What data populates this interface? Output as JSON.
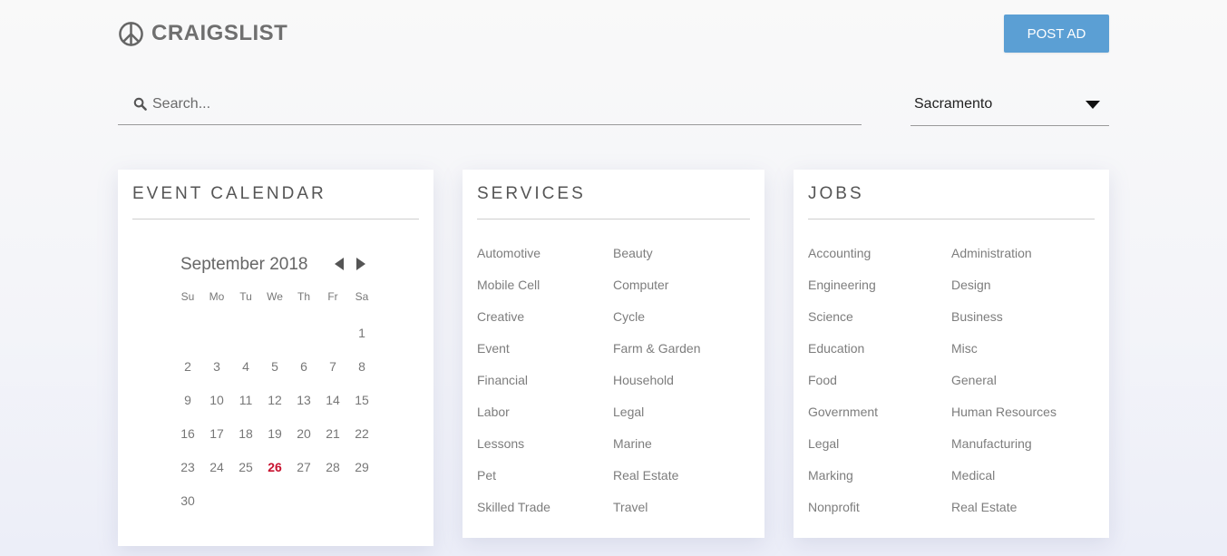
{
  "header": {
    "logo_text": "CRAIGSLIST",
    "post_ad_label": "POST AD"
  },
  "search": {
    "placeholder": "Search...",
    "value": ""
  },
  "city_select": {
    "selected": "Sacramento"
  },
  "calendar": {
    "title": "EVENT CALENDAR",
    "month_label": "September 2018",
    "weekdays": [
      "Su",
      "Mo",
      "Tu",
      "We",
      "Th",
      "Fr",
      "Sa"
    ],
    "leading_blanks": 6,
    "days": [
      "1",
      "2",
      "3",
      "4",
      "5",
      "6",
      "7",
      "8",
      "9",
      "10",
      "11",
      "12",
      "13",
      "14",
      "15",
      "16",
      "17",
      "18",
      "19",
      "20",
      "21",
      "22",
      "23",
      "24",
      "25",
      "26",
      "27",
      "28",
      "29",
      "30"
    ],
    "today": "26",
    "today_color": "#c8102e"
  },
  "services": {
    "title": "SERVICES",
    "col1": [
      "Automotive",
      "Mobile Cell",
      "Creative",
      "Event",
      "Financial",
      "Labor",
      "Lessons",
      "Pet",
      "Skilled Trade"
    ],
    "col2": [
      "Beauty",
      "Computer",
      "Cycle",
      "Farm & Garden",
      "Household",
      "Legal",
      "Marine",
      "Real Estate",
      "Travel"
    ]
  },
  "jobs": {
    "title": "JOBS",
    "col1": [
      "Accounting",
      "Engineering",
      "Science",
      "Education",
      "Food",
      "Government",
      "Legal",
      "Marking",
      "Nonprofit"
    ],
    "col2": [
      "Administration",
      "Design",
      "Business",
      "Misc",
      "General",
      "Human Resources",
      "Manufacturing",
      "Medical",
      "Real Estate"
    ]
  },
  "colors": {
    "accent": "#5b9fd4",
    "today": "#c8102e"
  },
  "icons": {
    "logo": "peace-sign-icon",
    "search": "search-icon",
    "dropdown": "caret-down-icon",
    "prev": "triangle-left-icon",
    "next": "triangle-right-icon"
  }
}
